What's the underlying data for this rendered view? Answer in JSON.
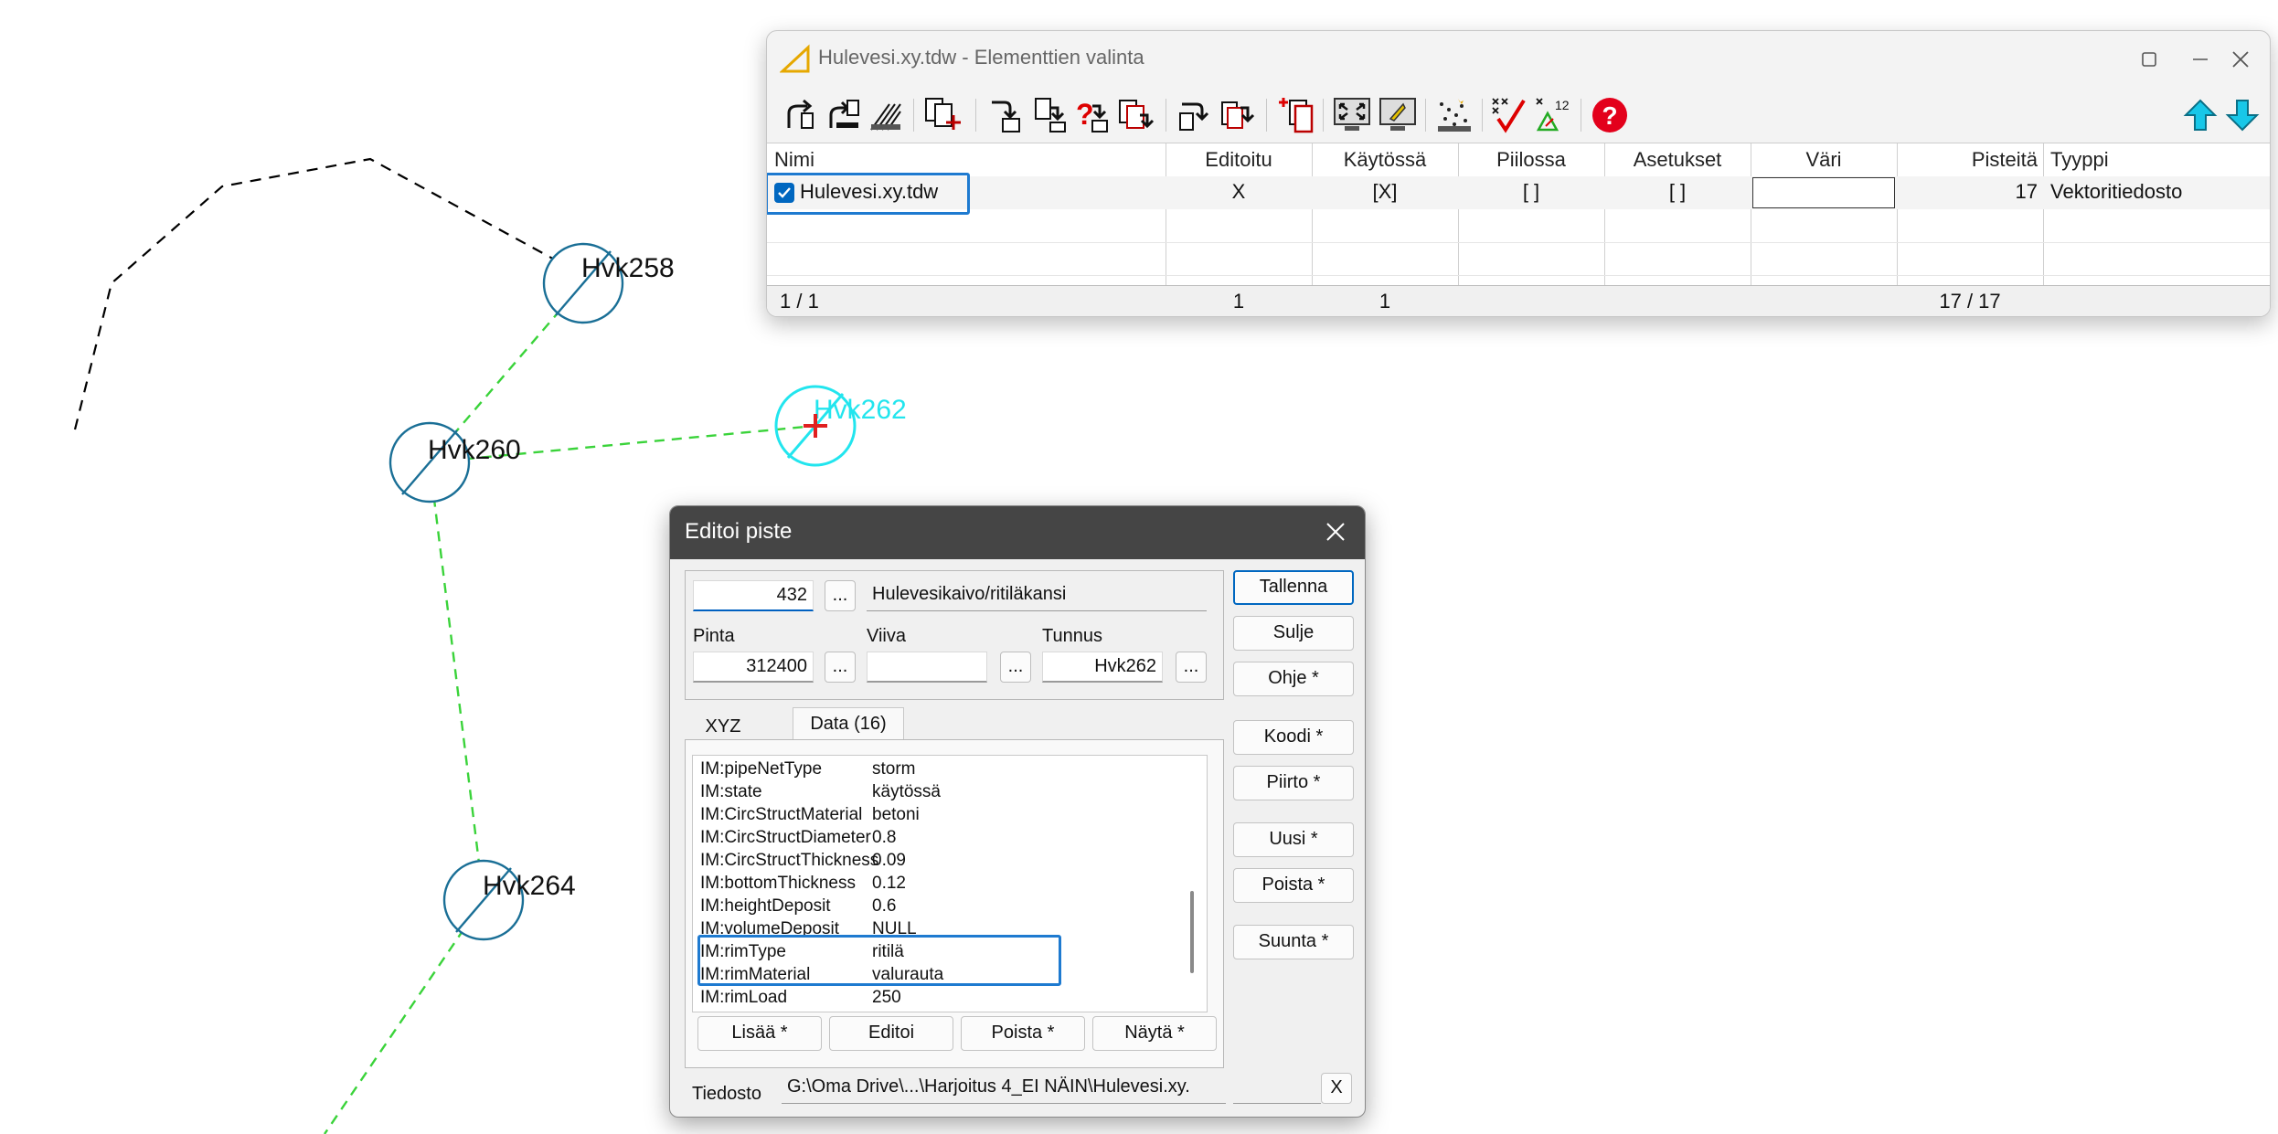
{
  "map": {
    "labels": [
      "Hvk258",
      "Hvk260",
      "Hvk262",
      "Hvk264"
    ],
    "selected_label": "Hvk262",
    "colors": {
      "pipe": "#3ad33a",
      "symbol": "#1a6f96",
      "selected": "#22e5ee",
      "marker": "#e02020",
      "boundary": "#000000"
    }
  },
  "elem_window": {
    "title": "Hulevesi.xy.tdw - Elementtien valinta",
    "controls": {
      "minimize": "minimize-icon",
      "maximize": "maximize-icon",
      "close": "close-icon"
    },
    "toolbar_icons": [
      "rotate-left-icon",
      "rotate-doc-icon",
      "hatch-icon",
      "doc-add-icon",
      "doc-move-down-icon",
      "doc-move-icon",
      "doc-question-icon",
      "doc-copy-icon",
      "doc-arrow-icon",
      "doc-arrow-red-icon",
      "doc-new-red-icon",
      "zoom-extents-icon",
      "monitor-icon",
      "points-icon",
      "check-x-icon",
      "point-numbers-icon",
      "help-icon",
      "arrow-up-icon",
      "arrow-down-icon"
    ],
    "columns": [
      "Nimi",
      "Editoitu",
      "Käytössä",
      "Piilossa",
      "Asetukset",
      "Väri",
      "Pisteitä",
      "Tyyppi"
    ],
    "rows": [
      {
        "checked": true,
        "name": "Hulevesi.xy.tdw",
        "edited": "X",
        "in_use": "[X]",
        "hidden": "[ ]",
        "settings": "[ ]",
        "color": "",
        "points": "17",
        "type": "Vektoritiedosto"
      }
    ],
    "footer": {
      "nimi": "1 / 1",
      "editoitu": "1",
      "kaytossa": "1",
      "pisteita": "17 / 17"
    }
  },
  "edit_dialog": {
    "title": "Editoi piste",
    "code_value": "432",
    "code_description": "Hulevesikaivo/ritiläkansi",
    "pinta_label": "Pinta",
    "pinta_value": "312400",
    "viiva_label": "Viiva",
    "viiva_value": "",
    "tunnus_label": "Tunnus",
    "tunnus_value": "Hvk262",
    "dots_label": "...",
    "tabs": [
      "XYZ",
      "Data (16)"
    ],
    "data_rows": [
      {
        "key": "IM:pipeNetType",
        "value": "storm"
      },
      {
        "key": "IM:state",
        "value": "käytössä"
      },
      {
        "key": "IM:CircStructMaterial",
        "value": "betoni"
      },
      {
        "key": "IM:CircStructDiameter",
        "value": "0.8"
      },
      {
        "key": "IM:CircStructThickness",
        "value": "0.09"
      },
      {
        "key": "IM:bottomThickness",
        "value": "0.12"
      },
      {
        "key": "IM:heightDeposit",
        "value": "0.6"
      },
      {
        "key": "IM:volumeDeposit",
        "value": "NULL"
      },
      {
        "key": "IM:rimType",
        "value": "ritilä"
      },
      {
        "key": "IM:rimMaterial",
        "value": "valurauta"
      },
      {
        "key": "IM:rimLoad",
        "value": "250"
      }
    ],
    "list_buttons": [
      "Lisää *",
      "Editoi",
      "Poista *",
      "Näytä *"
    ],
    "side_buttons": [
      "Tallenna",
      "Sulje",
      "Ohje *",
      "Koodi *",
      "Piirto *",
      "Uusi *",
      "Poista *",
      "Suunta *"
    ],
    "file_label": "Tiedosto",
    "file_path": "G:\\Oma Drive\\...\\Harjoitus 4_EI NÄIN\\Hulevesi.xy.",
    "file_clear": "X"
  }
}
